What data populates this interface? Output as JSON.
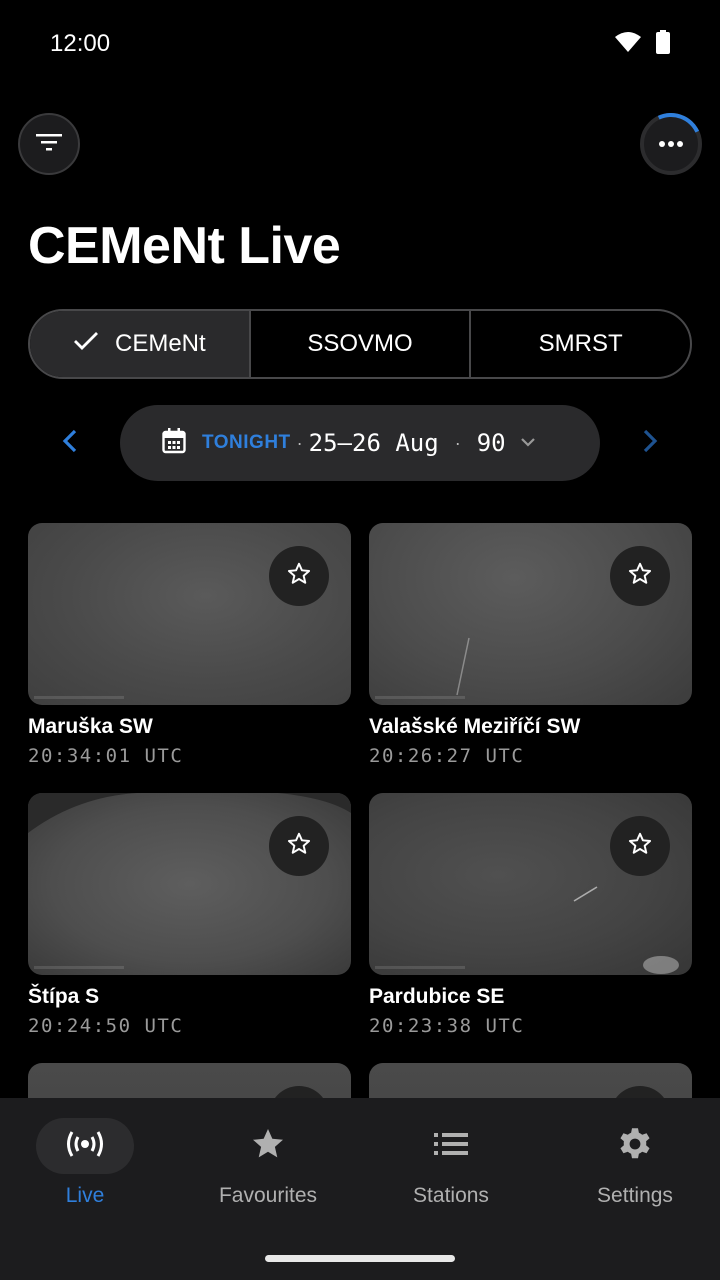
{
  "status_bar": {
    "time": "12:00",
    "icons": [
      "wifi-icon",
      "battery-icon"
    ]
  },
  "header": {
    "title": "CEMeNt Live",
    "filter_icon": "filter-icon",
    "more_icon": "more-horizontal-icon"
  },
  "networks": {
    "options": [
      {
        "label": "CEMeNt",
        "selected": true
      },
      {
        "label": "SSOVMO",
        "selected": false
      },
      {
        "label": "SMRST",
        "selected": false
      }
    ]
  },
  "date_selector": {
    "tonight_label": "TONIGHT",
    "separator": "·",
    "date_range": "25–26 Aug",
    "count": "90",
    "calendar_icon": "calendar-icon",
    "dropdown_icon": "chevron-down-icon",
    "prev_icon": "chevron-left-icon",
    "next_icon": "chevron-right-icon"
  },
  "stations": [
    {
      "name": "Maruška SW",
      "time": "20:34:01 UTC",
      "favourite": false
    },
    {
      "name": "Valašské Meziříčí SW",
      "time": "20:26:27 UTC",
      "favourite": false
    },
    {
      "name": "Štípa S",
      "time": "20:24:50 UTC",
      "favourite": false
    },
    {
      "name": "Pardubice SE",
      "time": "20:23:38 UTC",
      "favourite": false
    },
    {
      "name": "",
      "time": "",
      "favourite": false
    },
    {
      "name": "",
      "time": "",
      "favourite": false
    }
  ],
  "bottom_nav": {
    "items": [
      {
        "label": "Live",
        "icon": "broadcast-icon",
        "active": true
      },
      {
        "label": "Favourites",
        "icon": "star-icon",
        "active": false
      },
      {
        "label": "Stations",
        "icon": "list-icon",
        "active": false
      },
      {
        "label": "Settings",
        "icon": "gear-icon",
        "active": false
      }
    ]
  },
  "colors": {
    "accent": "#2f7fdc",
    "background": "#000000",
    "surface": "#1c1c1e"
  }
}
